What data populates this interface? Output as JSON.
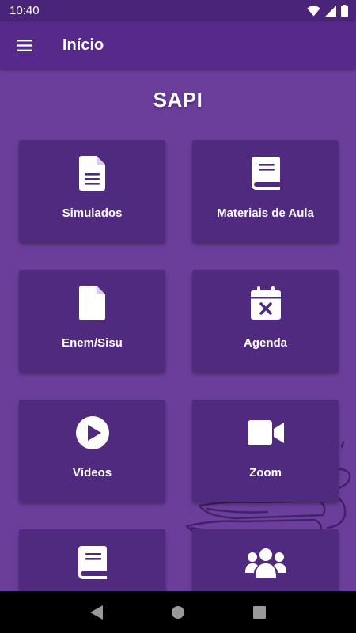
{
  "status_bar": {
    "time": "10:40",
    "icons": [
      "wifi-icon",
      "signal-icon",
      "battery-icon"
    ]
  },
  "app_bar": {
    "title": "Início",
    "menu_icon": "hamburger-menu-icon"
  },
  "page": {
    "title": "SAPI"
  },
  "cards": [
    {
      "label": "Simulados",
      "icon": "document-icon"
    },
    {
      "label": "Materiais de Aula",
      "icon": "book-icon"
    },
    {
      "label": "Enem/Sisu",
      "icon": "file-icon"
    },
    {
      "label": "Agenda",
      "icon": "calendar-x-icon"
    },
    {
      "label": "Vídeos",
      "icon": "play-circle-icon"
    },
    {
      "label": "Zoom",
      "icon": "video-camera-icon"
    },
    {
      "label": "",
      "icon": "book-icon"
    },
    {
      "label": "",
      "icon": "users-icon"
    }
  ],
  "nav_bar": {
    "buttons": [
      "back-icon",
      "home-icon",
      "recents-icon"
    ]
  },
  "colors": {
    "status_bar": "#4a2478",
    "app_bar": "#56298a",
    "background": "#6b3e9c",
    "card": "#4f2a7e",
    "text": "#ffffff"
  }
}
